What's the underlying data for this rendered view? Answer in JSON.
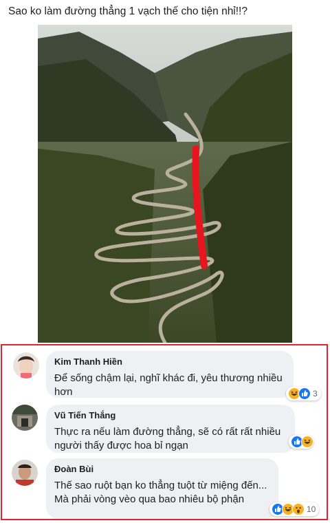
{
  "post": {
    "text": "Sao ko làm đường thẳng 1 vạch thế cho tiện nhỉ!!?"
  },
  "comments": [
    {
      "author": "Kim Thanh Hiền",
      "text": "Để sống chậm lại, nghĩ khác đi, yêu thương nhiều hơn",
      "reaction_count": "3",
      "reactions": [
        "haha-icon",
        "like-icon"
      ]
    },
    {
      "author": "Vũ Tiến Thắng",
      "text": "Thực ra nếu làm đường thẳng, sẽ có rất rất nhiều người thấy được hoa bỉ ngạn",
      "reaction_count": "",
      "reactions": [
        "like-icon",
        "haha-icon"
      ]
    },
    {
      "author": "Đoàn Bùi",
      "text": "Thế sao ruột bạn ko thẳng tuột từ miệng đến... Mà phải vòng vèo qua bao nhiêu bộ phận",
      "reaction_count": "10",
      "reactions": [
        "like-icon",
        "haha-icon",
        "wow-icon"
      ]
    }
  ],
  "colors": {
    "highlight_border": "#e0262b",
    "bubble": "#eef0f3",
    "like": "#1877f2",
    "haha": "#f7b125",
    "red_line": "#e8141e"
  }
}
